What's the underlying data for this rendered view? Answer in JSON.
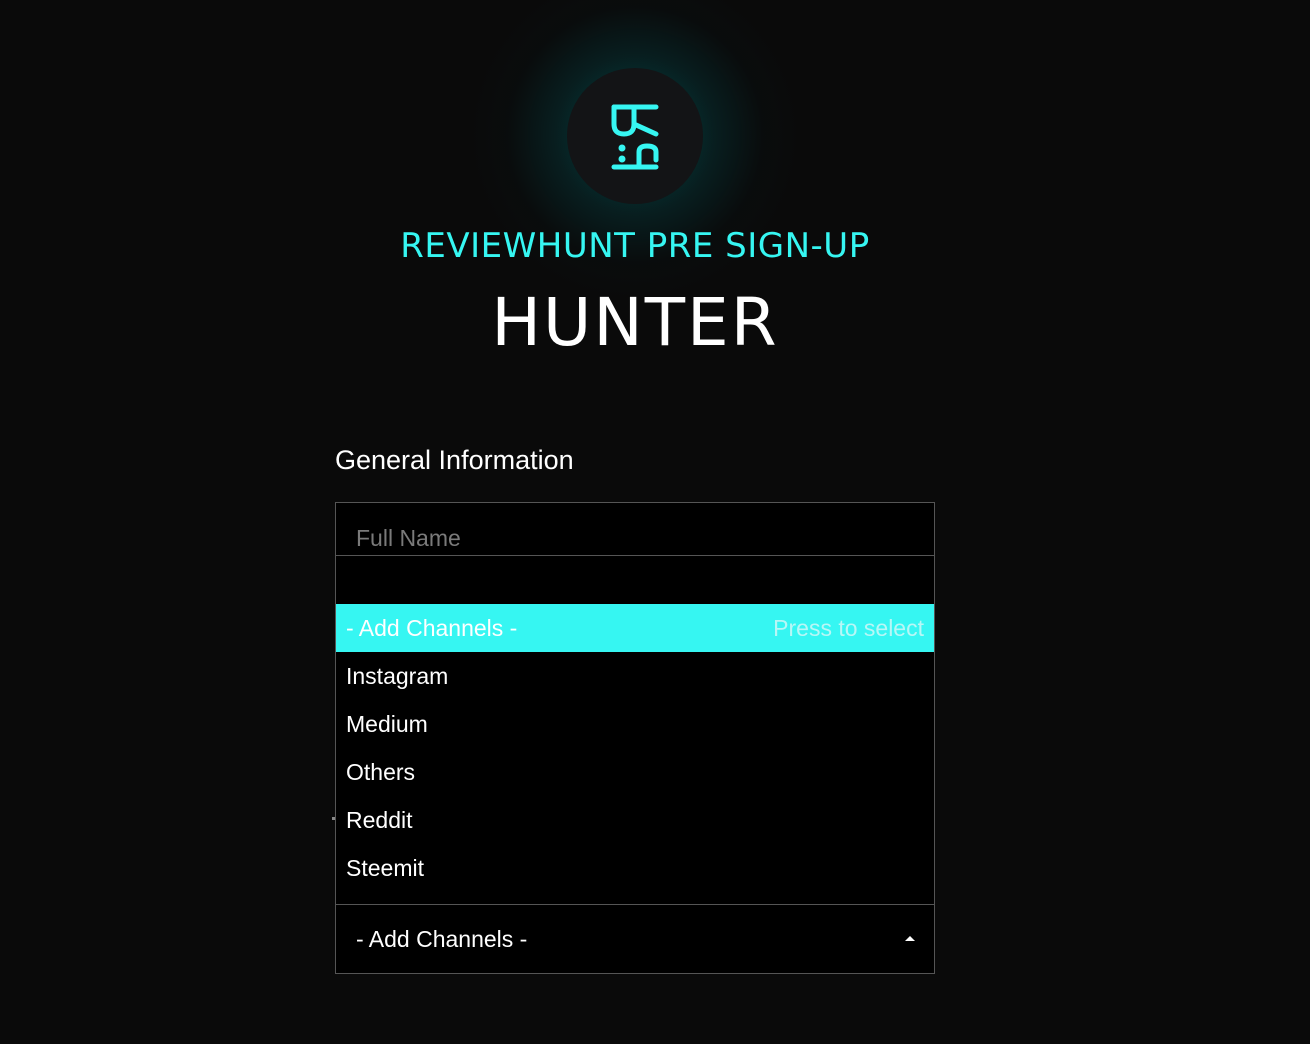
{
  "brand": {
    "logo_text": "R:h",
    "accent_color": "#36f6f2",
    "subtitle": "REVIEWHUNT PRE SIGN-UP",
    "title": "HUNTER"
  },
  "form": {
    "section_title": "General Information",
    "full_name_placeholder": "Full Name",
    "channels": {
      "selected_value": "- Add Channels -",
      "press_hint": "Press to select",
      "options": [
        "- Add Channels -",
        "Instagram",
        "Medium",
        "Others",
        "Reddit",
        "Steemit"
      ],
      "caret_icon": "caret-up-icon"
    }
  }
}
